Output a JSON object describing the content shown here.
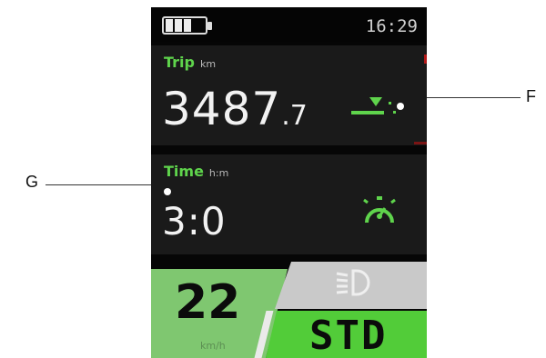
{
  "status": {
    "clock": "16:29",
    "battery_icon": "battery-icon",
    "battery_level": 0.6
  },
  "trip": {
    "label": "Trip",
    "unit": "km",
    "value_int": "3487",
    "value_dec": ".7",
    "icon": "trip-marker-icon"
  },
  "time": {
    "label": "Time",
    "unit": "h:m",
    "value": "3:0",
    "icon": "stopwatch-icon"
  },
  "speed": {
    "value": "22",
    "unit": "km/h"
  },
  "light": {
    "icon": "headlight-icon"
  },
  "mode": {
    "value": "STD"
  },
  "callouts": {
    "F": "F",
    "G": "G"
  },
  "colors": {
    "accent_green": "#5fd44c",
    "mode_green": "#52cc39",
    "speed_green": "#7fc770",
    "screen_bg": "#060606",
    "panel_bg": "#1a1a1a"
  }
}
